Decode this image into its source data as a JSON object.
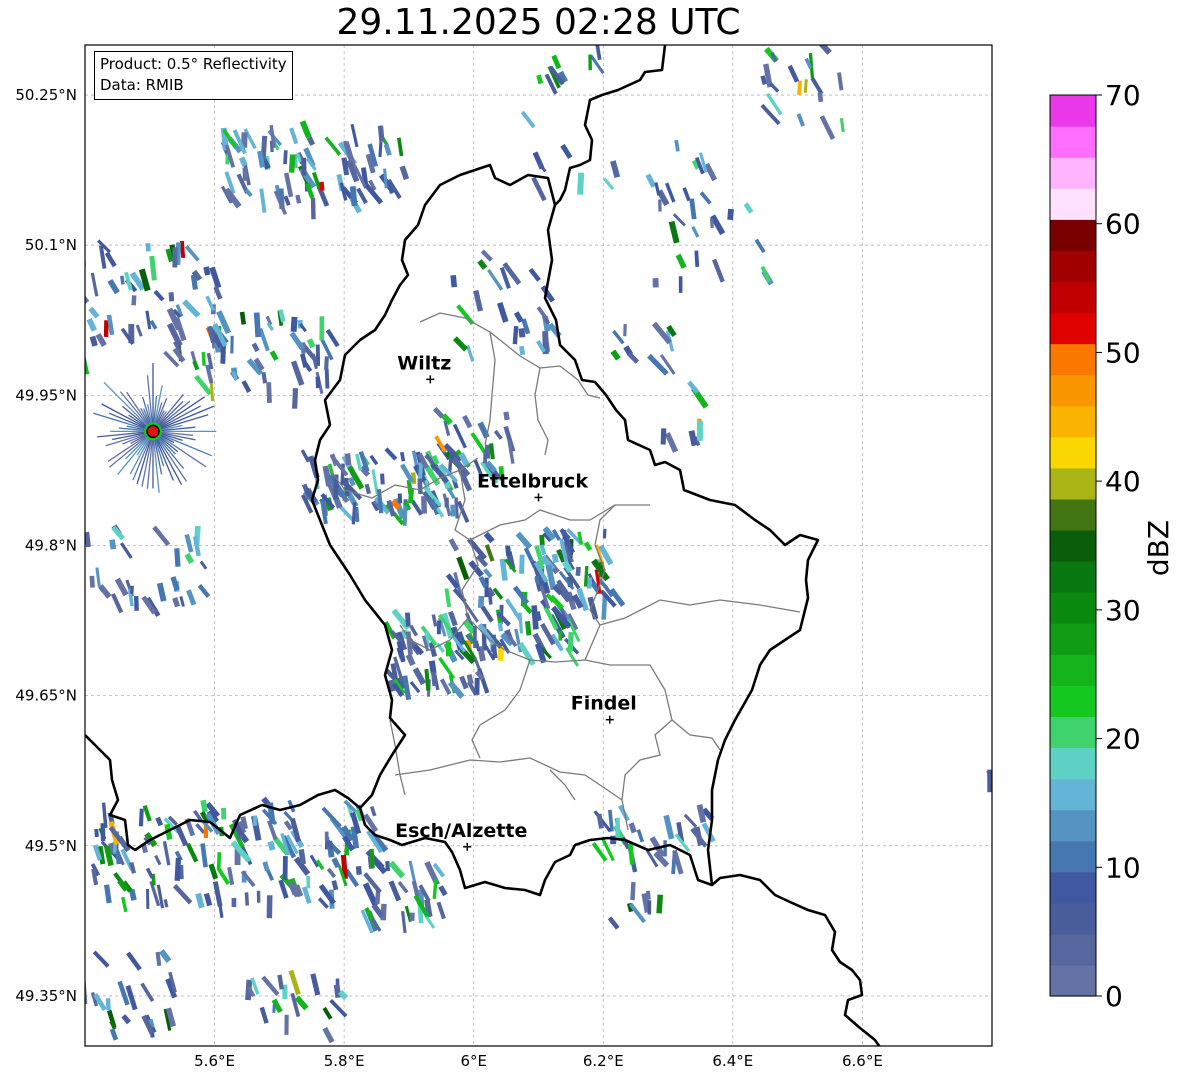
{
  "title": "29.11.2025 02:28 UTC",
  "info": {
    "product": "Product: 0.5° Reflectivity",
    "data": "Data: RMIB"
  },
  "map": {
    "lon_range": [
      5.4,
      6.8
    ],
    "lat_range": [
      49.3,
      50.3
    ],
    "lat_ticks": [
      {
        "value": 50.25,
        "label": "50.25°N"
      },
      {
        "value": 50.1,
        "label": "50.1°N"
      },
      {
        "value": 49.95,
        "label": "49.95°N"
      },
      {
        "value": 49.8,
        "label": "49.8°N"
      },
      {
        "value": 49.65,
        "label": "49.65°N"
      },
      {
        "value": 49.5,
        "label": "49.5°N"
      },
      {
        "value": 49.35,
        "label": "49.35°N"
      }
    ],
    "lon_ticks": [
      {
        "value": 5.6,
        "label": "5.6°E"
      },
      {
        "value": 5.8,
        "label": "5.8°E"
      },
      {
        "value": 6.0,
        "label": "6°E"
      },
      {
        "value": 6.2,
        "label": "6.2°E"
      },
      {
        "value": 6.4,
        "label": "6.4°E"
      },
      {
        "value": 6.6,
        "label": "6.6°E"
      }
    ],
    "cities": [
      {
        "name": "Wiltz",
        "lon": 5.933,
        "lat": 49.966
      },
      {
        "name": "Ettelbruck",
        "lon": 6.1,
        "lat": 49.848
      },
      {
        "name": "Findel",
        "lon": 6.21,
        "lat": 49.626
      },
      {
        "name": "Esch/Alzette",
        "lon": 5.99,
        "lat": 49.499
      }
    ],
    "radar_site": {
      "lon": 5.505,
      "lat": 49.914,
      "color": "#e01010"
    }
  },
  "colorbar": {
    "label": "dBZ",
    "min": 0,
    "max": 70,
    "ticks": [
      "0",
      "10",
      "20",
      "30",
      "40",
      "50",
      "60",
      "70"
    ],
    "colors": [
      "#6472a6",
      "#56679f",
      "#495c9c",
      "#3f58a0",
      "#4677b0",
      "#5594c2",
      "#64b4d8",
      "#5ed2c4",
      "#40d36d",
      "#14c820",
      "#14b41c",
      "#109c14",
      "#0c8a10",
      "#0a7810",
      "#0a5e0a",
      "#427612",
      "#aab414",
      "#fad700",
      "#fab400",
      "#fa9600",
      "#fa7800",
      "#e00000",
      "#c00000",
      "#a00000",
      "#780000",
      "#ffe0ff",
      "#ffb4ff",
      "#ff6eff",
      "#ea38ea"
    ]
  }
}
